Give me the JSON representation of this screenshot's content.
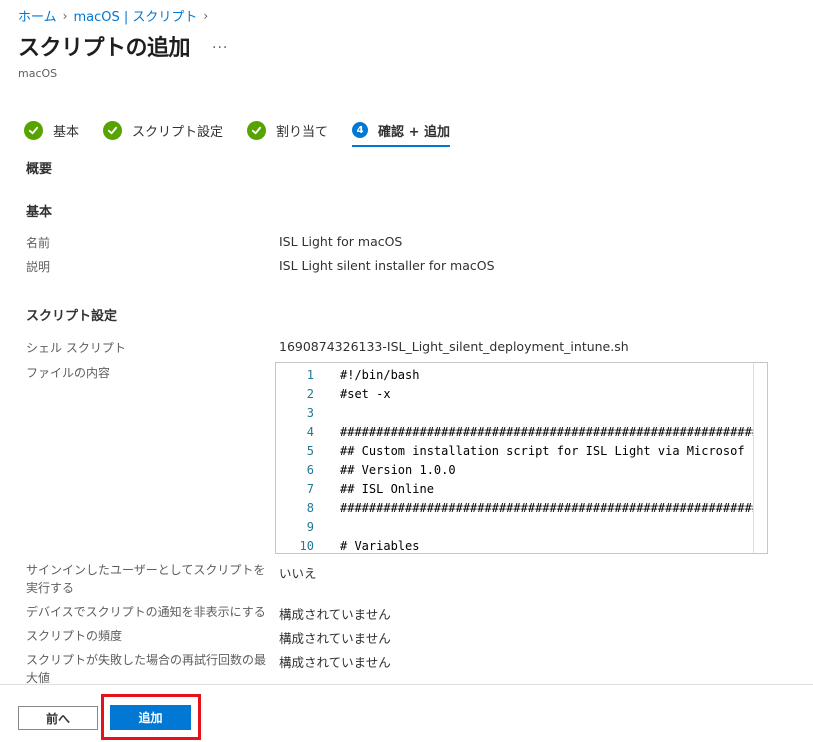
{
  "breadcrumb": {
    "home": "ホーム",
    "macos_scripts": "macOS | スクリプト"
  },
  "header": {
    "title": "スクリプトの追加",
    "subtitle": "macOS",
    "more": "···"
  },
  "steps": [
    {
      "label": "基本",
      "state": "done"
    },
    {
      "label": "スクリプト設定",
      "state": "done"
    },
    {
      "label": "割り当て",
      "state": "done"
    },
    {
      "label": "確認 + 追加",
      "state": "active",
      "number": "4"
    }
  ],
  "summary": {
    "overview_heading": "概要",
    "basics_heading": "基本",
    "name_label": "名前",
    "name_value": "ISL Light for macOS",
    "description_label": "説明",
    "description_value": "ISL Light silent installer for macOS",
    "script_settings_heading": "スクリプト設定",
    "shell_script_label": "シェル スクリプト",
    "shell_script_value": "1690874326133-ISL_Light_silent_deployment_intune.sh",
    "file_content_label": "ファイルの内容",
    "run_as_signed_in_label": "サインインしたユーザーとしてスクリプトを実行する",
    "run_as_signed_in_value": "いいえ",
    "hide_notifications_label": "デバイスでスクリプトの通知を非表示にする",
    "hide_notifications_value": "構成されていません",
    "frequency_label": "スクリプトの頻度",
    "frequency_value": "構成されていません",
    "max_retries_label": "スクリプトが失敗した場合の再試行回数の最大値",
    "max_retries_value": "構成されていません"
  },
  "code_lines": [
    {
      "num": "1",
      "text": "#!/bin/bash"
    },
    {
      "num": "2",
      "text": "#set -x"
    },
    {
      "num": "3",
      "text": ""
    },
    {
      "num": "4",
      "text": "##############################################################"
    },
    {
      "num": "5",
      "text": "## Custom installation script for ISL Light via Microsof"
    },
    {
      "num": "6",
      "text": "## Version 1.0.0"
    },
    {
      "num": "7",
      "text": "## ISL Online"
    },
    {
      "num": "8",
      "text": "##############################################################"
    },
    {
      "num": "9",
      "text": ""
    },
    {
      "num": "10",
      "text": "# Variables"
    }
  ],
  "footer": {
    "prev_label": "前へ",
    "add_label": "追加"
  },
  "colors": {
    "accent": "#0078d4",
    "success": "#57a300",
    "highlight": "#e5121b"
  }
}
